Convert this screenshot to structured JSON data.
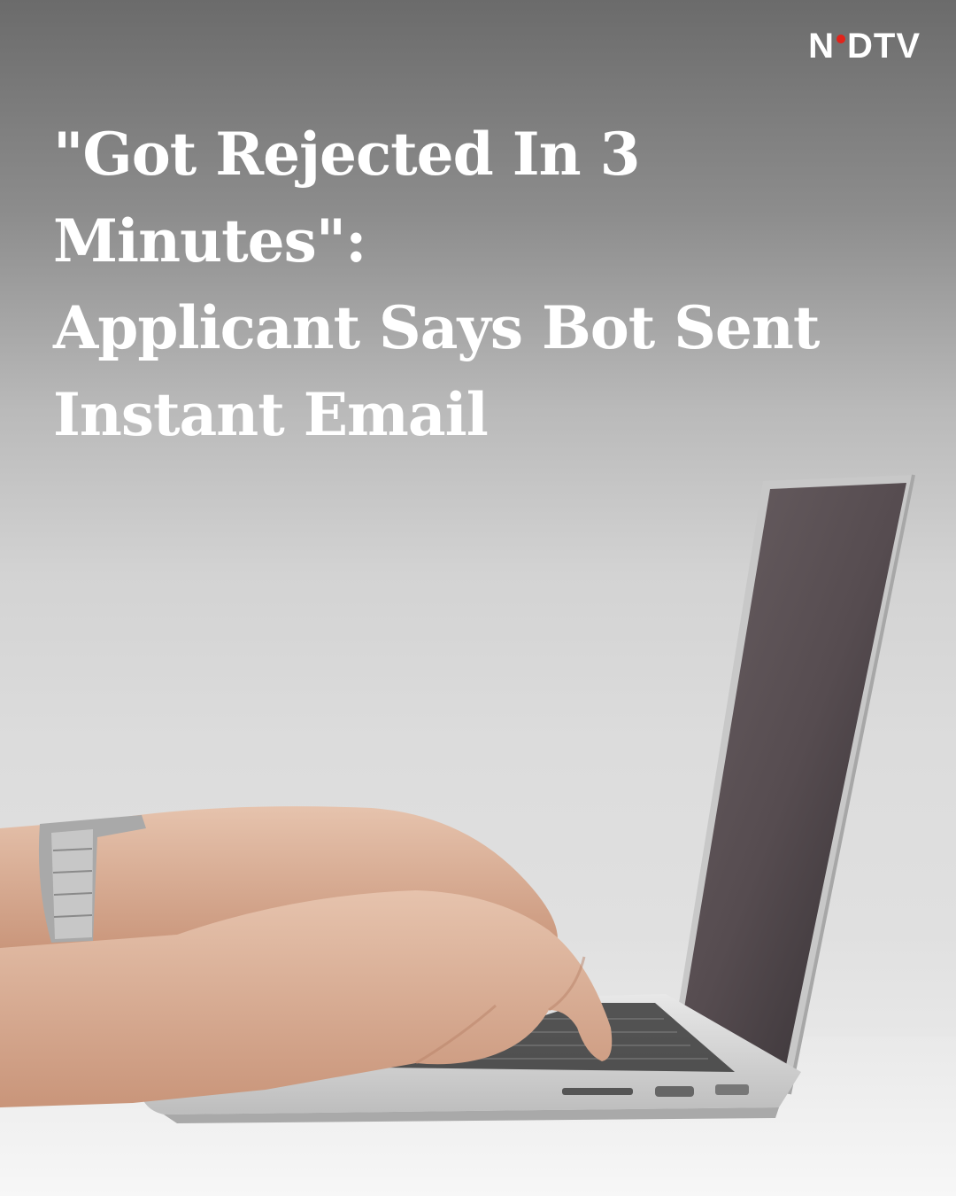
{
  "brand": {
    "left": "N",
    "right": "DTV",
    "dot_color": "#e2231a"
  },
  "headline": {
    "line1": "\"Got Rejected In 3 Minutes\":",
    "line2": "Applicant Says Bot Sent",
    "line3": "Instant Email"
  },
  "colors": {
    "text": "#ffffff"
  }
}
